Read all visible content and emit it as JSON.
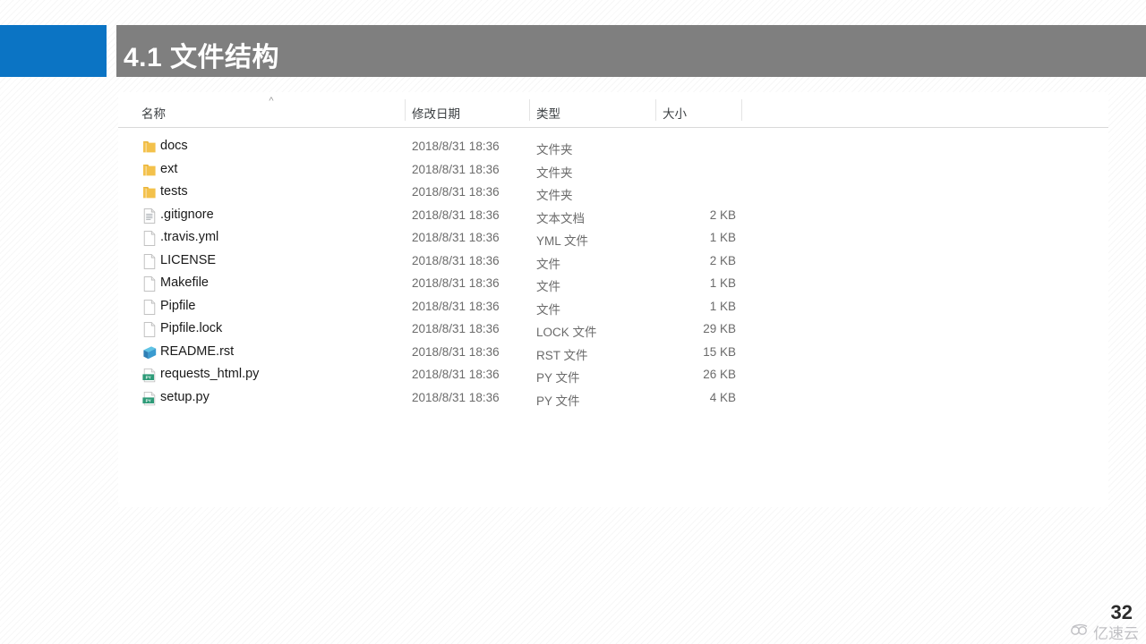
{
  "slide": {
    "title": "4.1 文件结构",
    "page_number": "32",
    "accent_color": "#0b74c4",
    "title_bar_color": "#7f7f7f"
  },
  "watermark": {
    "text": "亿速云",
    "icon": "cloud-icon"
  },
  "explorer": {
    "columns": [
      {
        "key": "name",
        "label": "名称"
      },
      {
        "key": "date",
        "label": "修改日期"
      },
      {
        "key": "type",
        "label": "类型"
      },
      {
        "key": "size",
        "label": "大小"
      }
    ],
    "sort": {
      "column": "名称",
      "direction": "ascending",
      "icon": "chevron-up-icon"
    },
    "rows": [
      {
        "icon": "folder-icon",
        "name": "docs",
        "date": "2018/8/31 18:36",
        "type": "文件夹",
        "size": ""
      },
      {
        "icon": "folder-icon",
        "name": "ext",
        "date": "2018/8/31 18:36",
        "type": "文件夹",
        "size": ""
      },
      {
        "icon": "folder-icon",
        "name": "tests",
        "date": "2018/8/31 18:36",
        "type": "文件夹",
        "size": ""
      },
      {
        "icon": "text-file-icon",
        "name": ".gitignore",
        "date": "2018/8/31 18:36",
        "type": "文本文档",
        "size": "2 KB"
      },
      {
        "icon": "blank-file-icon",
        "name": ".travis.yml",
        "date": "2018/8/31 18:36",
        "type": "YML 文件",
        "size": "1 KB"
      },
      {
        "icon": "blank-file-icon",
        "name": "LICENSE",
        "date": "2018/8/31 18:36",
        "type": "文件",
        "size": "2 KB"
      },
      {
        "icon": "blank-file-icon",
        "name": "Makefile",
        "date": "2018/8/31 18:36",
        "type": "文件",
        "size": "1 KB"
      },
      {
        "icon": "blank-file-icon",
        "name": "Pipfile",
        "date": "2018/8/31 18:36",
        "type": "文件",
        "size": "1 KB"
      },
      {
        "icon": "blank-file-icon",
        "name": "Pipfile.lock",
        "date": "2018/8/31 18:36",
        "type": "LOCK 文件",
        "size": "29 KB"
      },
      {
        "icon": "rst-file-icon",
        "name": "README.rst",
        "date": "2018/8/31 18:36",
        "type": "RST 文件",
        "size": "15 KB"
      },
      {
        "icon": "python-file-icon",
        "name": "requests_html.py",
        "date": "2018/8/31 18:36",
        "type": "PY 文件",
        "size": "26 KB"
      },
      {
        "icon": "python-file-icon",
        "name": "setup.py",
        "date": "2018/8/31 18:36",
        "type": "PY 文件",
        "size": "4 KB"
      }
    ]
  }
}
